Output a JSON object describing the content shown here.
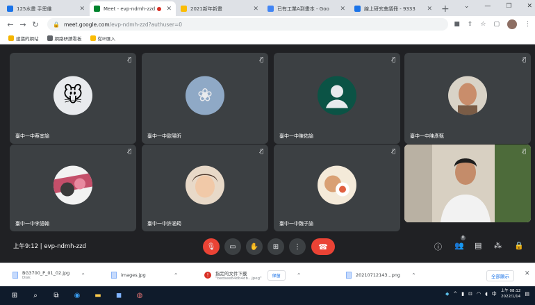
{
  "browser": {
    "tabs": [
      {
        "title": "125水畫 手思維",
        "fav": "#1a73e8"
      },
      {
        "title": "Meet - evp-ndmh-zzd",
        "fav": "#00832d",
        "active": true
      },
      {
        "title": "2021新年新畫",
        "fav": "#fbbc04"
      },
      {
        "title": "已有工業A到畫本 - Goo",
        "fav": "#4285f4"
      },
      {
        "title": "線上研究會議冊 - 9333",
        "fav": "#1a73e8"
      }
    ],
    "new_tab": "+",
    "url_host": "meet.google.com",
    "url_path": "/evp-ndmh-zzd?authuser=0",
    "bookmarks": [
      {
        "label": "建議的網站",
        "color": "#f4b400"
      },
      {
        "label": "網路研讀看板",
        "color": "#5f6368"
      },
      {
        "label": "從IE匯入",
        "color": "#fbbc04"
      }
    ]
  },
  "meet": {
    "participants": [
      {
        "name": "臺中一中蔡宜諭",
        "kind": "icon",
        "bg": "#e8eaed",
        "glyph": "🐭"
      },
      {
        "name": "臺中一中歐陽昕",
        "kind": "icon",
        "bg": "#8fa9c6",
        "glyph": "❀"
      },
      {
        "name": "臺中一中陳佑諭",
        "kind": "person",
        "bg": "#0b5345",
        "glyph": "👤"
      },
      {
        "name": "臺中一中陳彥甄",
        "kind": "photo",
        "bg": "#b58a6a",
        "glyph": ""
      },
      {
        "name": "臺中一中李語翰",
        "kind": "photo",
        "bg": "#c44f6a",
        "glyph": ""
      },
      {
        "name": "臺中一中許涵筠",
        "kind": "photo",
        "bg": "#d6b7a0",
        "glyph": ""
      },
      {
        "name": "臺中一中魏子諭",
        "kind": "photo",
        "bg": "#d9a074",
        "glyph": ""
      }
    ],
    "time": "上午9:12",
    "separator": "|",
    "meeting_code": "evp-ndmh-zzd",
    "people_count": "8"
  },
  "downloads": [
    {
      "name": "BG3700_P_01_02.jpg",
      "sub": "Disk"
    },
    {
      "name": "images.jpg",
      "sub": ""
    },
    {
      "name": "指定的文件下載",
      "sub": "\"bedsee84db4db...jpeg\"",
      "warn": true,
      "keep": "保留"
    },
    {
      "name": "20210712143...png",
      "sub": ""
    }
  ],
  "downloads_show_all": "全部顯示",
  "taskbar": {
    "time": "上午 08:12",
    "date": "2022/1/14"
  }
}
